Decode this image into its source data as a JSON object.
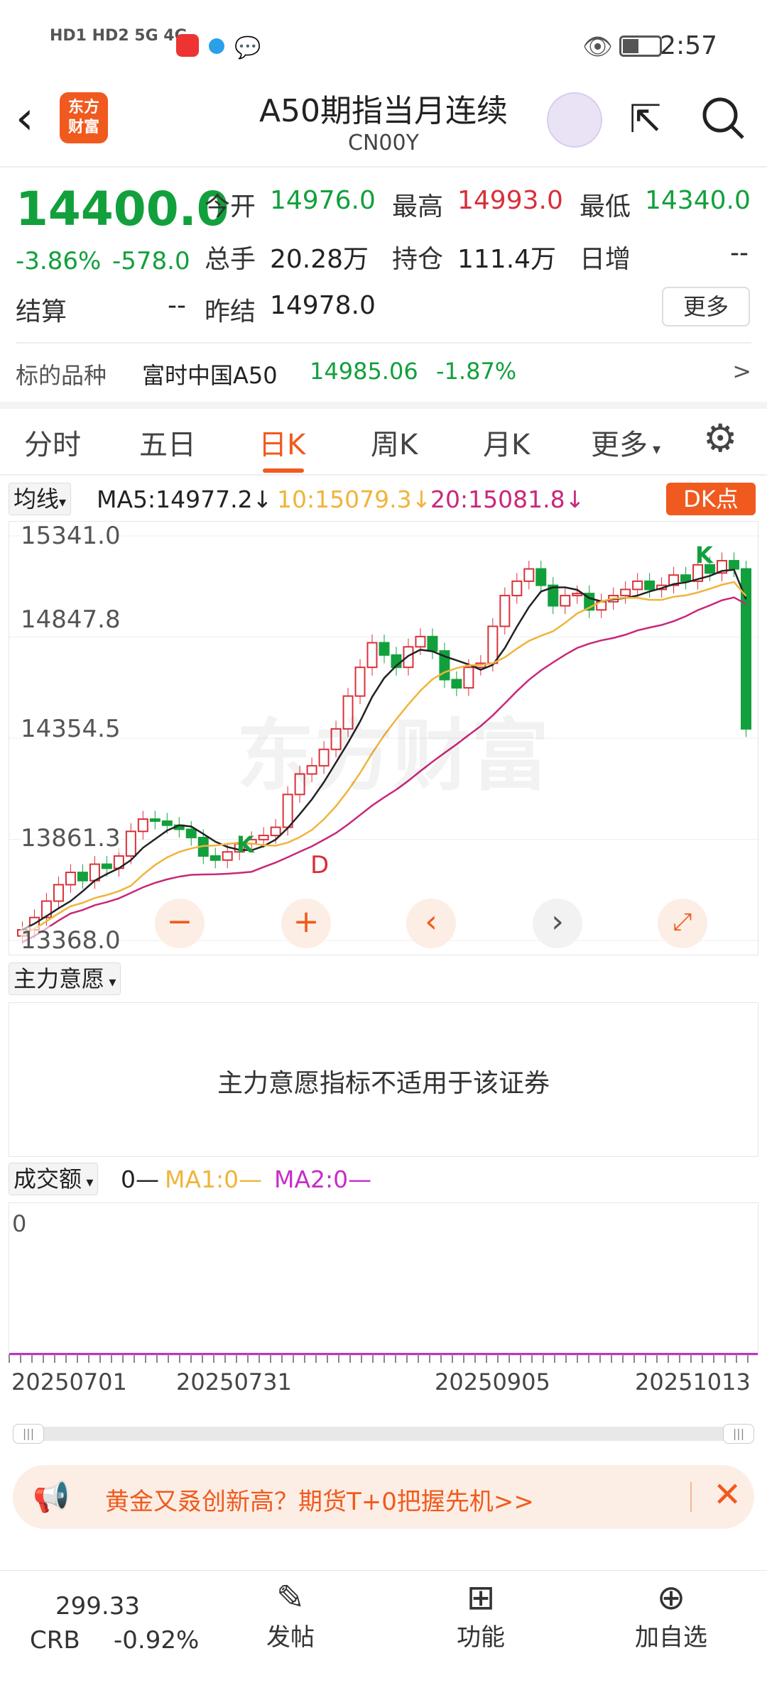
{
  "status": {
    "left_icons": "HD1 HD2 5G 4G",
    "time": "2:57"
  },
  "nav": {
    "logo_line1": "东方",
    "logo_line2": "财富",
    "title": "A50期指当月连续",
    "subtitle": "CN00Y"
  },
  "quote": {
    "price": "14400.0",
    "change_pct": "-3.86%",
    "change": "-578.0",
    "open_label": "今开",
    "open": "14976.0",
    "high_label": "最高",
    "high": "14993.0",
    "low_label": "最低",
    "low": "14340.0",
    "volume_label": "总手",
    "volume": "20.28万",
    "oi_label": "持仓",
    "oi": "111.4万",
    "daily_inc_label": "日增",
    "daily_inc": "--",
    "settle_label": "结算",
    "settle": "--",
    "prev_settle_label": "昨结",
    "prev_settle": "14978.0",
    "more_label": "更多"
  },
  "underlying": {
    "label": "标的品种",
    "name": "富时中国A50",
    "price": "14985.06",
    "pct": "-1.87%",
    "arrow": ">"
  },
  "tabs": [
    "分时",
    "五日",
    "日K",
    "周K",
    "月K",
    "更多"
  ],
  "ma_bar": {
    "selector": "均线",
    "ma5": "MA5:14977.2",
    "ma10": "10:15079.3",
    "ma20": "20:15081.8",
    "dk_label": "DK点"
  },
  "chart": {
    "y_labels": [
      "15341.0",
      "14847.8",
      "14354.5",
      "13861.3",
      "13368.0"
    ],
    "watermark": "东方财富",
    "d_label": "D",
    "k_label": "K"
  },
  "chart_data": {
    "type": "candlestick",
    "ylim": [
      13368.0,
      15341.0
    ],
    "ma_series": [
      {
        "name": "MA5",
        "color": "#222222"
      },
      {
        "name": "MA10",
        "color": "#f0b43c"
      },
      {
        "name": "MA20",
        "color": "#c8287a"
      }
    ],
    "closes": [
      13420,
      13480,
      13560,
      13640,
      13700,
      13660,
      13740,
      13720,
      13780,
      13900,
      13960,
      13950,
      13930,
      13910,
      13870,
      13780,
      13760,
      13800,
      13840,
      13860,
      13880,
      13920,
      14080,
      14180,
      14220,
      14300,
      14400,
      14560,
      14700,
      14820,
      14760,
      14700,
      14800,
      14850,
      14780,
      14640,
      14600,
      14700,
      14720,
      14900,
      15050,
      15120,
      15180,
      15100,
      15000,
      15050,
      15060,
      14980,
      15020,
      15050,
      15080,
      15120,
      15080,
      15100,
      15150,
      15120,
      15200,
      15160,
      15220,
      15180,
      14400
    ]
  },
  "indicator": {
    "selector": "主力意愿",
    "message": "主力意愿指标不适用于该证券"
  },
  "volume": {
    "selector": "成交额",
    "zero": "0",
    "val": "0",
    "ma1": "MA1:0",
    "ma2": "MA2:0",
    "axis_zero": "0"
  },
  "x_labels": [
    "20250701",
    "20250731",
    "20250905",
    "20251013"
  ],
  "banner": {
    "text": "黄金又叒创新高？期货T+0把握先机>>"
  },
  "bottom": {
    "crb_value": "299.33",
    "crb_label": "CRB",
    "crb_pct": "-0.92%",
    "post": "发帖",
    "func": "功能",
    "add": "加自选"
  },
  "colors": {
    "accent": "#f05a1e",
    "down": "#12a03c",
    "up": "#d9303a"
  }
}
